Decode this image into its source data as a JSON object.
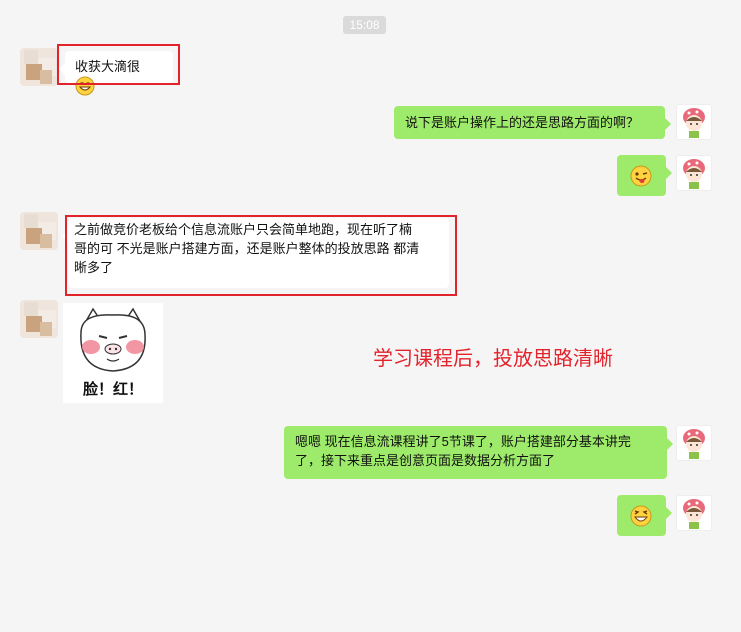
{
  "timestamp": "15:08",
  "messages": {
    "m1": {
      "text": "收获大滴很"
    },
    "m2": {
      "text": "说下是账户操作上的还是思路方面的啊？"
    },
    "m4": {
      "line1": "之前做竞价老板给个信息流账户只会简单地跑，现在听了楠",
      "line2": "哥的可 不光是账户搭建方面，还是账户整体的投放思路 都清",
      "line3": "晰多了"
    },
    "m5": {
      "sticker_caption": "脸！红！"
    },
    "m6": {
      "line1": "嗯嗯 现在信息流课程讲了5节课了，账户搭建部分基本讲完",
      "line2": "了，接下来重点是创意页面是数据分析方面了"
    }
  },
  "annotation": "学习课程后，投放思路清晰",
  "colors": {
    "sent_bubble": "#9eea6a",
    "received_bubble": "#ffffff",
    "highlight": "#e3232c",
    "background": "#f5f5f5"
  },
  "icons": [
    "grin-emoji",
    "wink-tongue-emoji",
    "laugh-emoji",
    "blush-pig-sticker"
  ]
}
